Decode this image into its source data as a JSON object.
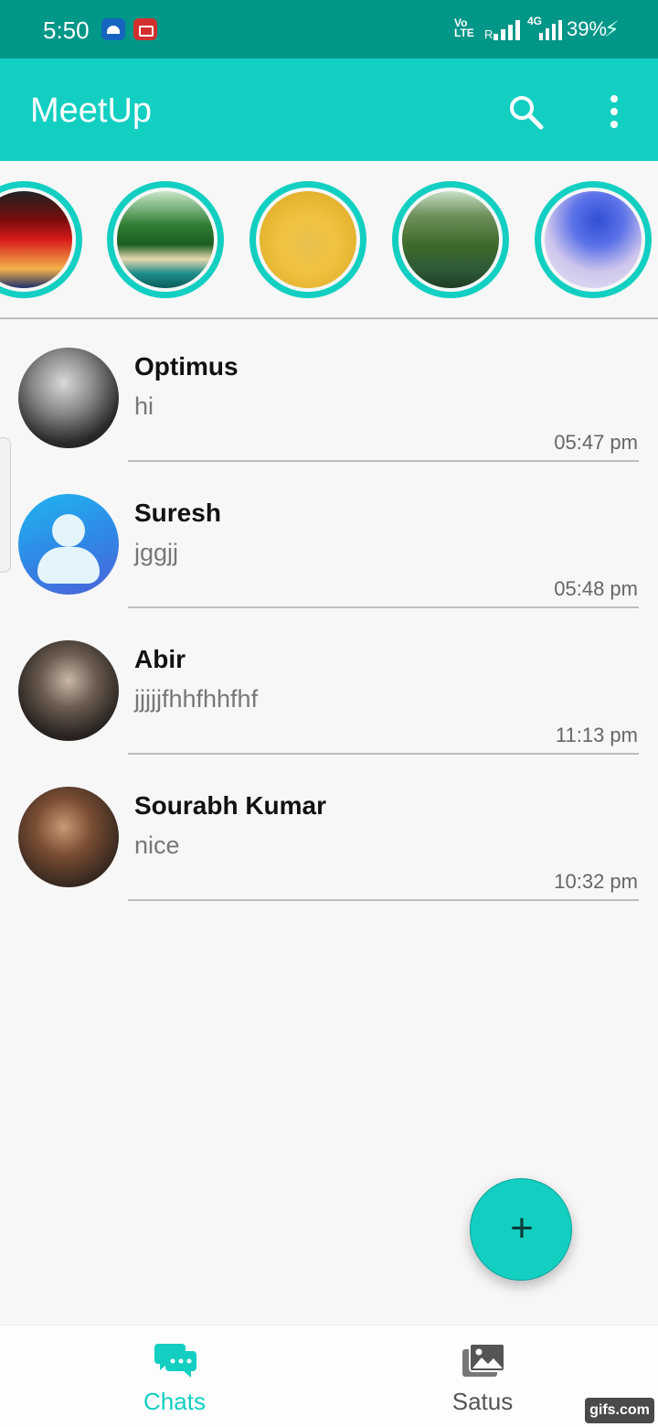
{
  "status_bar": {
    "time": "5:50",
    "network_label": "Vo LTE",
    "roaming": "R",
    "data_type": "4G",
    "battery": "39%"
  },
  "app_bar": {
    "title": "MeetUp",
    "search_icon": "search-icon",
    "more_icon": "more-vert-icon",
    "accent_color": "#13cfc2"
  },
  "stories": [
    {
      "icon": "story-avatar"
    },
    {
      "icon": "story-avatar"
    },
    {
      "icon": "story-avatar"
    },
    {
      "icon": "story-avatar"
    },
    {
      "icon": "story-avatar"
    }
  ],
  "chats": [
    {
      "name": "Optimus",
      "message": "hi",
      "time": "05:47 pm"
    },
    {
      "name": "Suresh",
      "message": "jggjj",
      "time": "05:48 pm"
    },
    {
      "name": "Abir",
      "message": "jjjjjfhhfhhfhf",
      "time": "11:13 pm"
    },
    {
      "name": "Sourabh Kumar",
      "message": "nice",
      "time": "10:32 pm"
    }
  ],
  "fab": {
    "label": "+",
    "icon": "add-icon"
  },
  "bottom_nav": {
    "chats_label": "Chats",
    "status_label": "Satus",
    "active": "Chats"
  },
  "watermark": "gifs.com"
}
